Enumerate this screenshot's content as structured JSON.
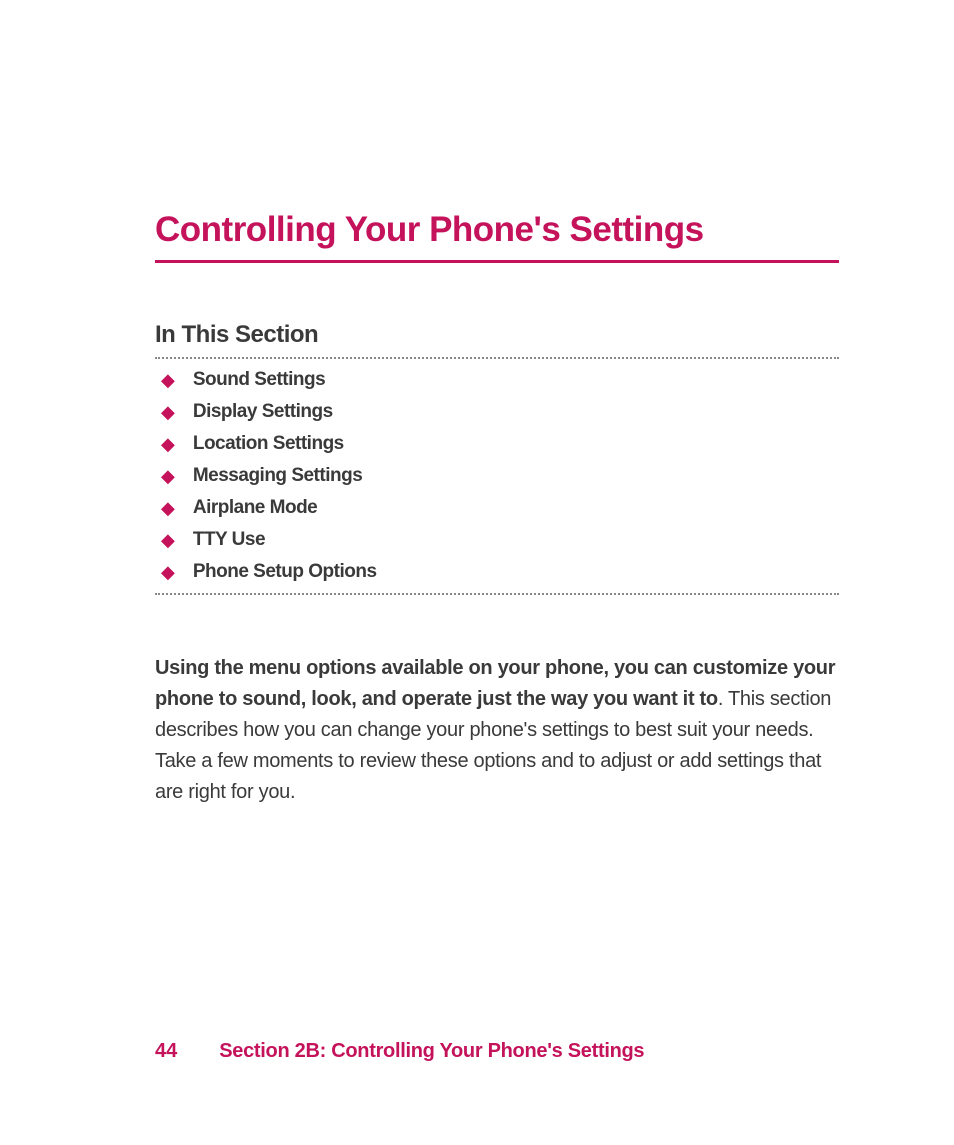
{
  "title": "Controlling Your Phone's Settings",
  "section_heading": "In This Section",
  "toc": [
    "Sound Settings",
    "Display Settings",
    "Location Settings",
    "Messaging Settings",
    "Airplane Mode",
    "TTY Use",
    "Phone Setup Options"
  ],
  "body": {
    "bold_lead": "Using the menu options available on your phone, you can customize your phone to sound, look, and operate just the way you want it to",
    "rest": ". This section describes how you can change your phone's settings to best suit your needs. Take a few moments to review these options and to adjust or add settings that are right for you."
  },
  "footer": {
    "page_number": "44",
    "label": "Section 2B: Controlling Your Phone's Settings"
  },
  "bullet_glyph": "◆"
}
